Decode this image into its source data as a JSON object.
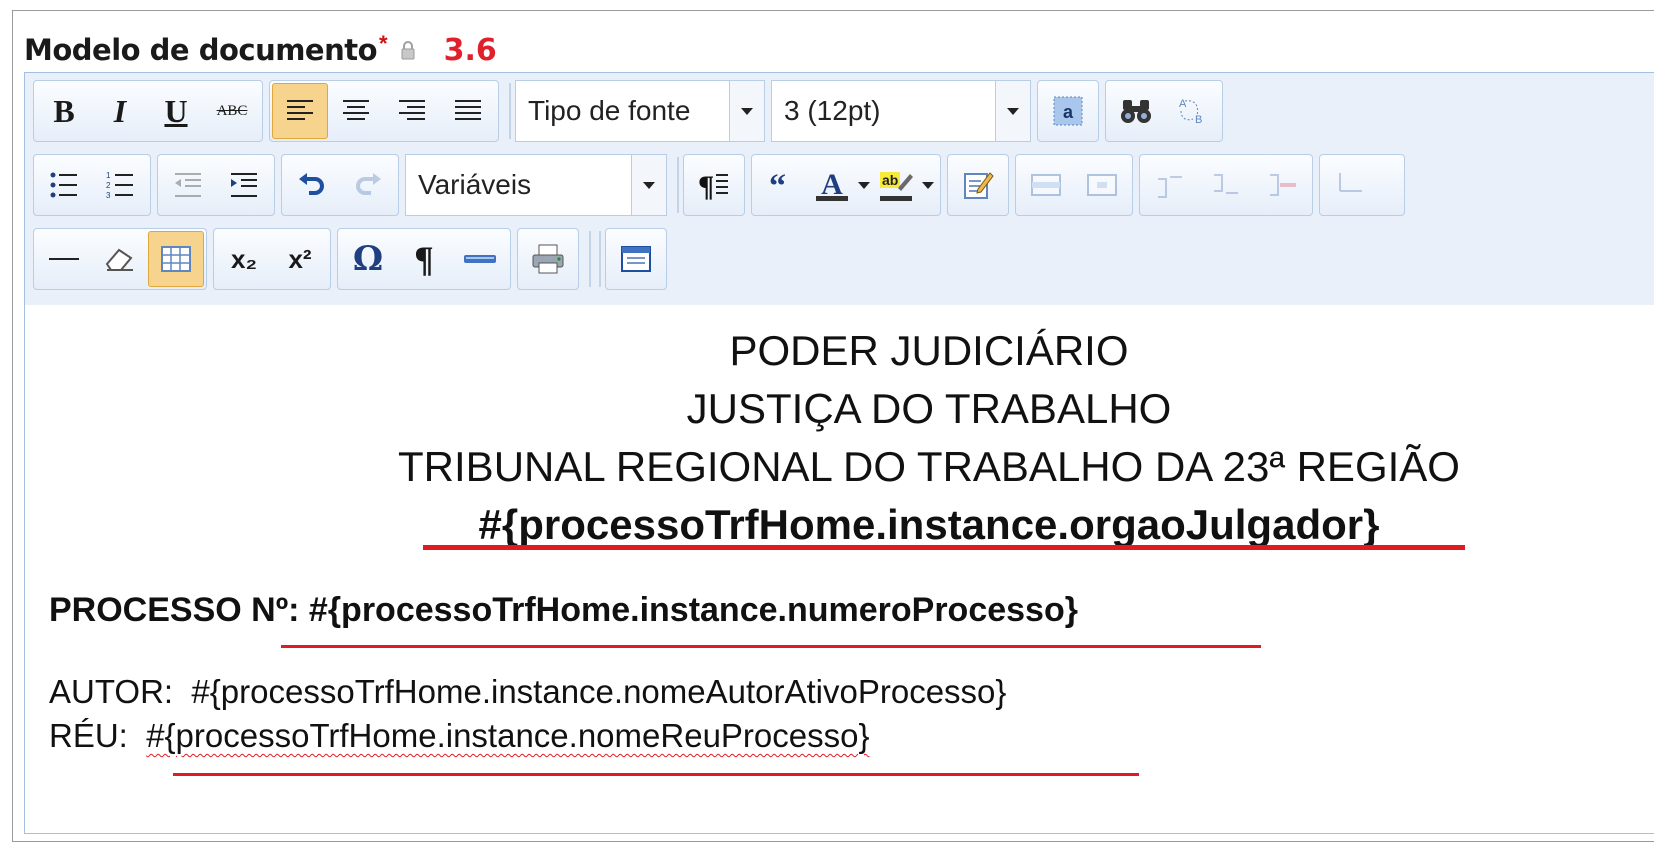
{
  "field": {
    "label": "Modelo de documento",
    "required_mark": "*",
    "version": "3.6"
  },
  "toolbar": {
    "row1": {
      "bold": "B",
      "italic": "I",
      "underline": "U",
      "strikethrough": "ABC",
      "font_type": "Tipo de fonte",
      "font_size": "3 (12pt)"
    },
    "row2": {
      "variables": "Variáveis"
    },
    "row3": {
      "hr": "—",
      "subscript": "x₂",
      "superscript": "x²",
      "omega": "Ω",
      "pilcrow": "¶"
    }
  },
  "document": {
    "header_line1": "PODER JUDICIÁRIO",
    "header_line2": "JUSTIÇA DO TRABALHO",
    "header_line3": "TRIBUNAL REGIONAL DO TRABALHO DA 23ª REGIÃO",
    "header_line4": "#{processoTrfHome.instance.orgaoJulgador}",
    "processo_label": "PROCESSO Nº:",
    "processo_value": "#{processoTrfHome.instance.numeroProcesso}",
    "autor_label": "AUTOR:",
    "autor_value": "#{processoTrfHome.instance.nomeAutorAtivoProcesso}",
    "reu_label": "RÉU:",
    "reu_value": "#{processoTrfHome.instance.nomeReuProcesso}"
  },
  "colors": {
    "accent_red": "#e11b22",
    "toolbar_bg": "#e9f0fa",
    "active_button": "#f6d48e"
  }
}
